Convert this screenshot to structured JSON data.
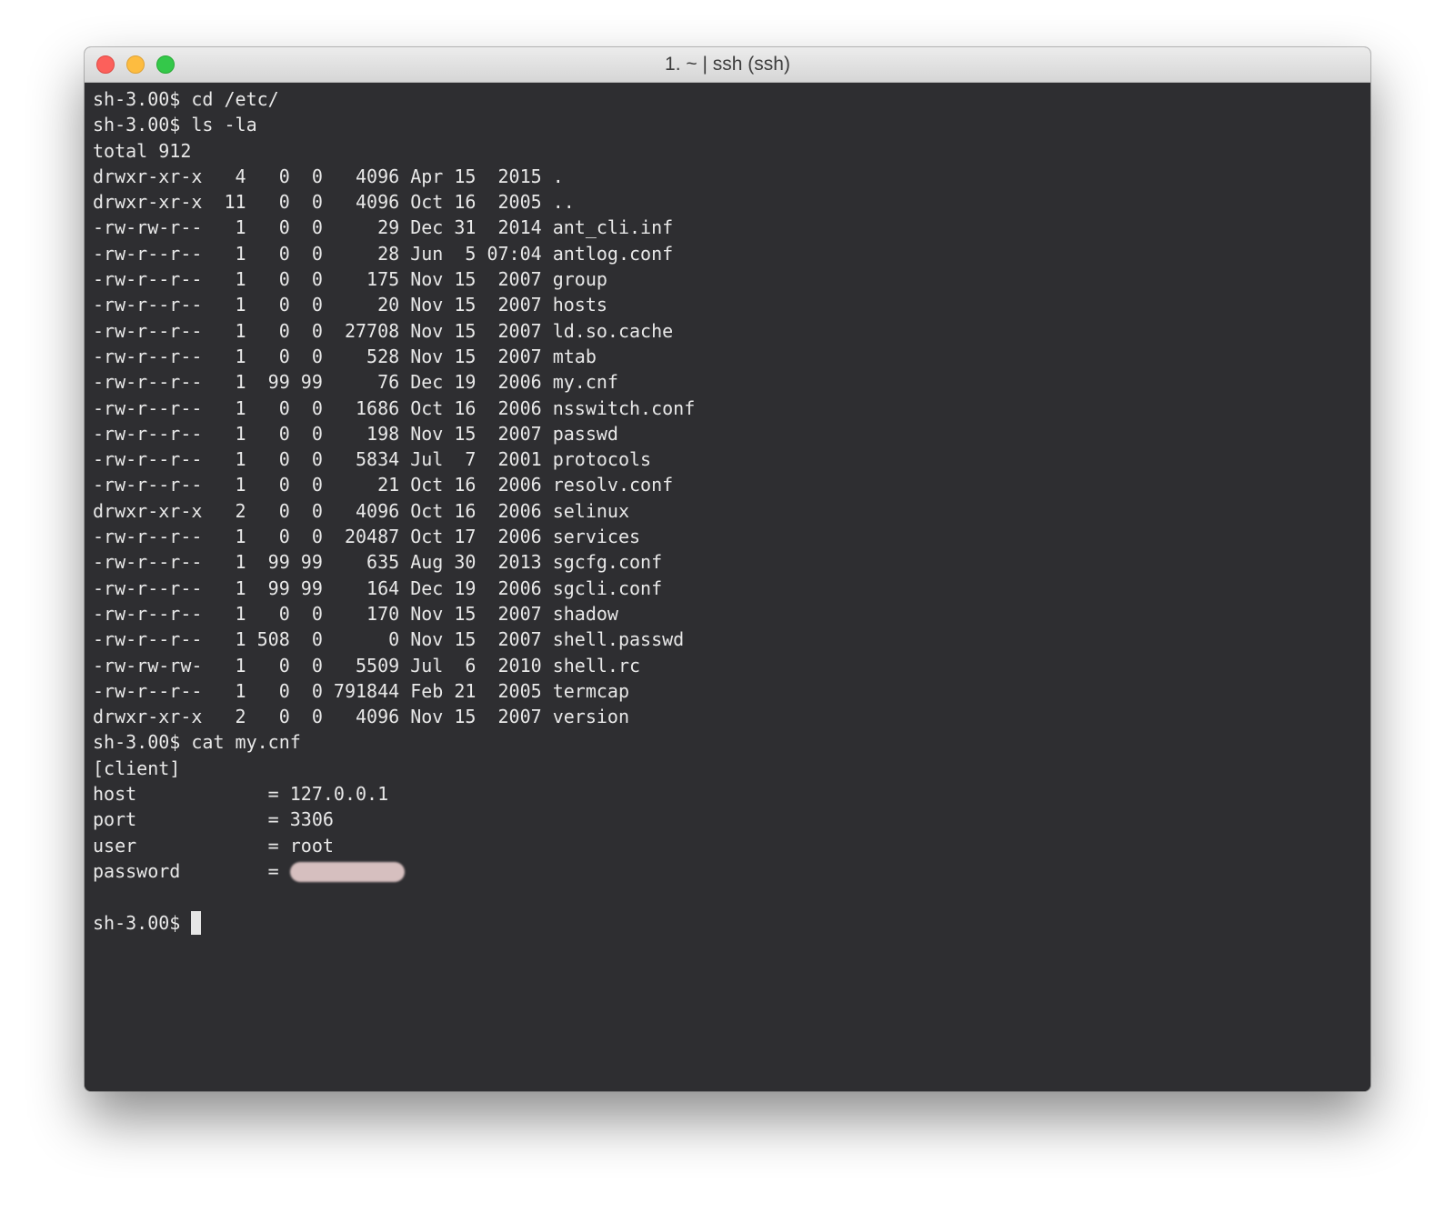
{
  "window": {
    "title": "1. ~ | ssh (ssh)"
  },
  "colors": {
    "terminal_bg": "#2e2e31",
    "terminal_fg": "#e8e8e8",
    "close": "#fc605b",
    "minimize": "#fdbc40",
    "maximize": "#34c84a"
  },
  "terminal": {
    "lines": [
      "sh-3.00$ cd /etc/",
      "sh-3.00$ ls -la",
      "total 912",
      "drwxr-xr-x   4   0  0   4096 Apr 15  2015 .",
      "drwxr-xr-x  11   0  0   4096 Oct 16  2005 ..",
      "-rw-rw-r--   1   0  0     29 Dec 31  2014 ant_cli.inf",
      "-rw-r--r--   1   0  0     28 Jun  5 07:04 antlog.conf",
      "-rw-r--r--   1   0  0    175 Nov 15  2007 group",
      "-rw-r--r--   1   0  0     20 Nov 15  2007 hosts",
      "-rw-r--r--   1   0  0  27708 Nov 15  2007 ld.so.cache",
      "-rw-r--r--   1   0  0    528 Nov 15  2007 mtab",
      "-rw-r--r--   1  99 99     76 Dec 19  2006 my.cnf",
      "-rw-r--r--   1   0  0   1686 Oct 16  2006 nsswitch.conf",
      "-rw-r--r--   1   0  0    198 Nov 15  2007 passwd",
      "-rw-r--r--   1   0  0   5834 Jul  7  2001 protocols",
      "-rw-r--r--   1   0  0     21 Oct 16  2006 resolv.conf",
      "drwxr-xr-x   2   0  0   4096 Oct 16  2006 selinux",
      "-rw-r--r--   1   0  0  20487 Oct 17  2006 services",
      "-rw-r--r--   1  99 99    635 Aug 30  2013 sgcfg.conf",
      "-rw-r--r--   1  99 99    164 Dec 19  2006 sgcli.conf",
      "-rw-r--r--   1   0  0    170 Nov 15  2007 shadow",
      "-rw-r--r--   1 508  0      0 Nov 15  2007 shell.passwd",
      "-rw-rw-rw-   1   0  0   5509 Jul  6  2010 shell.rc",
      "-rw-r--r--   1   0  0 791844 Feb 21  2005 termcap",
      "drwxr-xr-x   2   0  0   4096 Nov 15  2007 version",
      "sh-3.00$ cat my.cnf",
      "[client]",
      "host            = 127.0.0.1",
      "port            = 3306",
      "user            = root"
    ],
    "password_line": "password        = ",
    "blank_line": "",
    "current_prompt": "sh-3.00$ "
  }
}
